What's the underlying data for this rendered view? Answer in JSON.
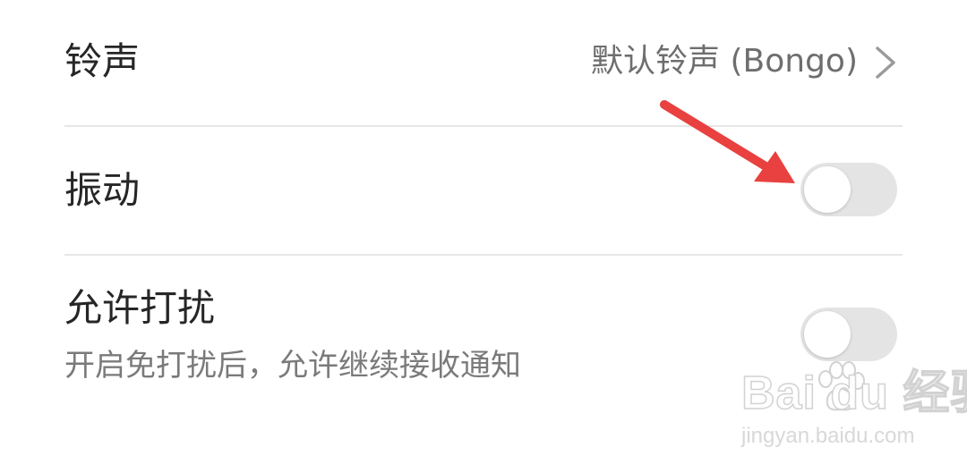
{
  "settings": {
    "ringtone": {
      "title": "铃声",
      "value": "默认铃声 (Bongo)",
      "chevron_icon": "chevron-right-icon"
    },
    "vibrate": {
      "title": "振动",
      "toggle_on": false
    },
    "do_not_disturb": {
      "title": "允许打扰",
      "subtitle": "开启免打扰后，允许继续接收通知",
      "toggle_on": false
    }
  },
  "annotation": {
    "icon": "red-arrow-icon",
    "color": "#e8413f",
    "points_to": "vibrate-toggle"
  },
  "watermark": {
    "logo": "Bai du 经验",
    "url": "jingyan.baidu.com"
  },
  "colors": {
    "toggle_off_track": "#e4e4e4",
    "toggle_knob": "#ffffff",
    "divider": "#e6e6e6",
    "title_text": "#262626",
    "secondary_text": "#7a7a7a"
  }
}
